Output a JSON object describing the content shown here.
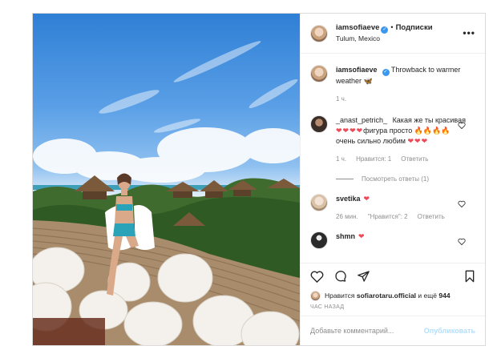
{
  "header": {
    "username": "iamsofiaeve",
    "verified_badge": "✓",
    "separator": "•",
    "follow_label": "Подписки",
    "location": "Tulum, Mexico",
    "more_icon": "more-icon"
  },
  "caption": {
    "username": "iamsofiaeve",
    "text": "Throwback to warmer weather 🦋",
    "time": "1 ч."
  },
  "comments": [
    {
      "username": "_anast_petrich_",
      "text_a": "Какая же ты красивая ",
      "hearts_a": "❤❤❤❤",
      "text_b": "фигура просто ",
      "fire": "🔥🔥🔥🔥",
      "text_c": "очень сильно любим ",
      "hearts_b": "❤❤❤",
      "time": "1 ч.",
      "likes": "Нравится: 1",
      "reply": "Ответить",
      "view_replies": "Посмотреть ответы (1)"
    },
    {
      "username": "svetika",
      "hearts": "❤",
      "time": "26 мин.",
      "likes": "\"Нравится\": 2",
      "reply": "Ответить"
    },
    {
      "username": "shmn",
      "hearts": "❤"
    }
  ],
  "likes": {
    "prefix": "Нравится",
    "user": "sofiarotaru.official",
    "middle": "и ещё",
    "count": "944"
  },
  "time_ago": "ЧАС НАЗАД",
  "comment_input": {
    "placeholder": "Добавьте комментарий...",
    "publish_label": "Опубликовать"
  },
  "colors": {
    "accent": "#3897f0",
    "heart": "#ed4956",
    "muted": "#8e8e8e"
  }
}
